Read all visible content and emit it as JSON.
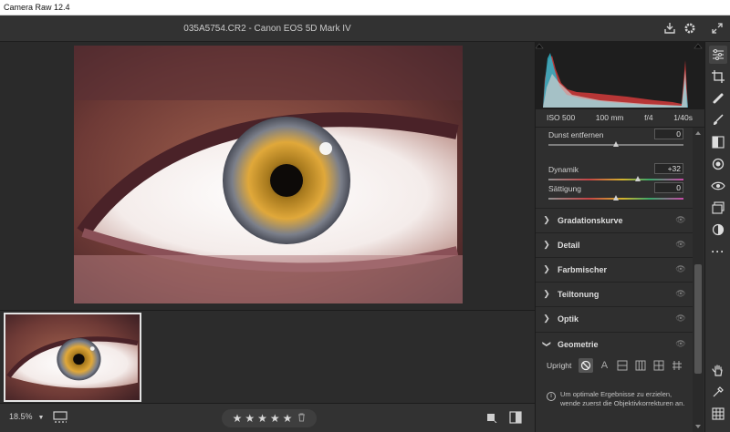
{
  "window": {
    "title": "Camera Raw 12.4"
  },
  "header": {
    "file_title": "035A5754.CR2  -  Canon EOS 5D Mark IV",
    "save_icon": "save-icon",
    "settings_icon": "gear-icon",
    "fullscreen_icon": "expand-icon"
  },
  "exif": {
    "iso": "ISO 500",
    "focal": "100 mm",
    "aperture": "f/4",
    "shutter": "1/40s"
  },
  "sliders": [
    {
      "label": "Dunst entfernen",
      "value": "0",
      "position": 0.5
    },
    {
      "label": "Dynamik",
      "value": "+32",
      "position": 0.66
    },
    {
      "label": "Sättigung",
      "value": "0",
      "position": 0.5
    }
  ],
  "sections": [
    {
      "label": "Gradationskurve",
      "expanded": false
    },
    {
      "label": "Detail",
      "expanded": false
    },
    {
      "label": "Farbmischer",
      "expanded": false
    },
    {
      "label": "Teiltonung",
      "expanded": false
    },
    {
      "label": "Optik",
      "expanded": false
    },
    {
      "label": "Geometrie",
      "expanded": true
    }
  ],
  "geometry": {
    "upright_label": "Upright",
    "upright_options": [
      "off",
      "auto",
      "level",
      "vertical",
      "full",
      "guided"
    ],
    "info_text": "Um optimale Ergebnisse zu erzielen, wende zuerst die Objektivkorrekturen an."
  },
  "bottom": {
    "zoom": "18.5%",
    "stars": [
      "★",
      "★",
      "★",
      "★",
      "★"
    ],
    "rating": 0
  },
  "tools": [
    "edit-sliders-icon",
    "crop-icon",
    "healing-icon",
    "brush-icon",
    "gradient-icon",
    "radial-filter-icon",
    "redeye-icon",
    "snapshots-icon",
    "presets-icon",
    "more-icon",
    "hand-icon",
    "color-sampler-icon",
    "grid-overlay-icon"
  ],
  "colors": {
    "accent": "#4a4a4a",
    "panel": "#2f2f2f",
    "background": "#262626"
  }
}
